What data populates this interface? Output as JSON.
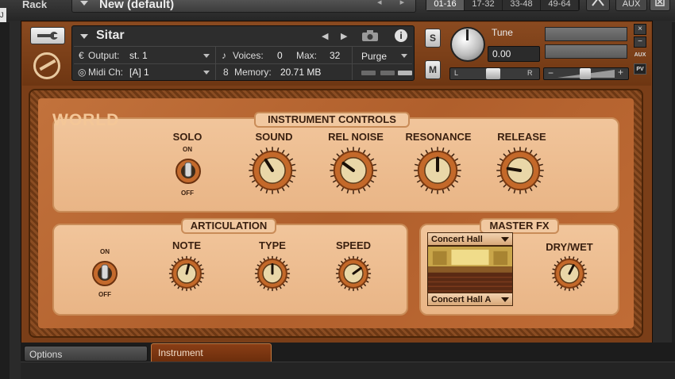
{
  "rack": {
    "label": "Rack",
    "multi_name": "New (default)",
    "nav": "◂ ▸",
    "midi_pages": [
      "01-16",
      "17-32",
      "33-48",
      "49-64"
    ],
    "active_page": 0,
    "aux_label": "AUX",
    "view_icon": "rack-view-icon",
    "close_icon": "close-icon"
  },
  "instrument_header": {
    "name": "Sitar",
    "output_label": "Output:",
    "output_value": "st. 1",
    "midi_label": "Midi Ch:",
    "midi_value": "[A]  1",
    "voices_label": "Voices:",
    "voices_value": "0",
    "max_label": "Max:",
    "max_value": "32",
    "memory_label": "Memory:",
    "memory_value": "20.71 MB",
    "purge_label": "Purge",
    "solo_label": "S",
    "mute_label": "M",
    "tune_label": "Tune",
    "tune_value": "0.00",
    "pan_left": "L",
    "pan_right": "R",
    "vol_minus": "−",
    "vol_plus": "+",
    "close_label": "×",
    "minimize_label": "−",
    "aux_label": "AUX",
    "pv_label": "PV",
    "icons": [
      "wrench-icon",
      "ni-logo-icon",
      "camera-icon",
      "info-icon",
      "output-icon",
      "midi-icon",
      "voices-icon",
      "memory-icon"
    ]
  },
  "panel": {
    "world_label": "WORLD",
    "instrument_controls": {
      "title": "INSTRUMENT CONTROLS",
      "solo": {
        "label": "SOLO",
        "on": "ON",
        "off": "OFF"
      },
      "knobs": [
        {
          "label": "SOUND",
          "value": 0.38
        },
        {
          "label": "REL NOISE",
          "value": 0.3
        },
        {
          "label": "RESONANCE",
          "value": 0.5
        },
        {
          "label": "RELEASE",
          "value": 0.2
        }
      ]
    },
    "articulation": {
      "title": "ARTICULATION",
      "switch": {
        "on": "ON",
        "off": "OFF"
      },
      "knobs": [
        {
          "label": "NOTE",
          "value": 0.55
        },
        {
          "label": "TYPE",
          "value": 0.5
        },
        {
          "label": "SPEED",
          "value": 0.7
        }
      ]
    },
    "master_fx": {
      "title": "MASTER FX",
      "reverb_type": "Concert Hall",
      "reverb_preset": "Concert Hall A",
      "drywet_label": "DRY/WET",
      "drywet_value": 0.6
    }
  },
  "bottom_tabs": {
    "options": "Options",
    "instrument": "Instrument"
  },
  "colors": {
    "wood": "#b05f2c",
    "panel_face": "#eab88a",
    "label_text": "#3a2010",
    "header": "#7a3e18"
  }
}
